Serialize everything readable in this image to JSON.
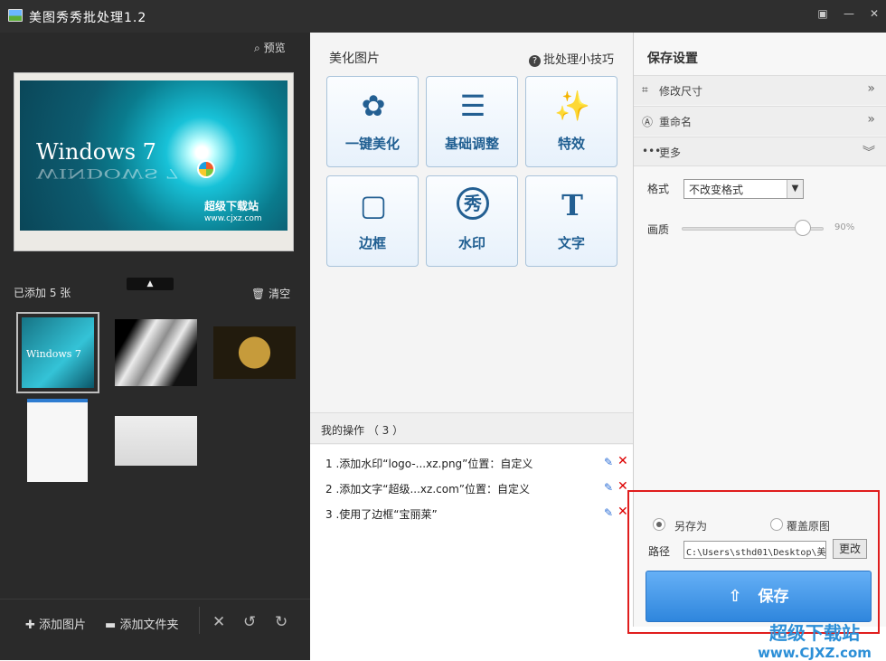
{
  "window": {
    "title": "美图秀秀批处理1.2"
  },
  "left_panel": {
    "preview_label": "预览",
    "preview_text": {
      "windows": "Windows 7",
      "windows_reflection": "WINDOWS 7",
      "site_cn": "超级下载站",
      "site_url": "www.cjxz.com"
    },
    "added_label": "已添加 5 张",
    "clear_label": "清空",
    "thumbnails": [
      {
        "text": "Windows 7"
      },
      {
        "text": ""
      },
      {
        "text": ""
      },
      {
        "text": ""
      },
      {
        "text": ""
      }
    ],
    "bottom": {
      "add_images": "添加图片",
      "add_folder": "添加文件夹"
    }
  },
  "middle_panel": {
    "title": "美化图片",
    "tips": "批处理小技巧",
    "tools": [
      {
        "label": "一键美化"
      },
      {
        "label": "基础调整"
      },
      {
        "label": "特效"
      },
      {
        "label": "边框"
      },
      {
        "label": "水印"
      },
      {
        "label": "文字"
      }
    ],
    "operations_title": "我的操作 （ 3 ）",
    "operations": [
      "1 .添加水印“logo-...xz.png”位置：自定义",
      "2 .添加文字“超级...xz.com”位置：自定义",
      "3 .使用了边框“宝丽莱”"
    ]
  },
  "right_panel": {
    "title": "保存设置",
    "sections": [
      {
        "label": "修改尺寸"
      },
      {
        "label": "重命名"
      },
      {
        "label": "更多"
      }
    ],
    "format_label": "格式",
    "format_value": "不改变格式",
    "quality_label": "画质",
    "quality_value": "90%",
    "quality_level": 0.9,
    "save_as_label": "另存为",
    "overwrite_label": "覆盖原图",
    "path_label": "路径",
    "path_value": "C:\\Users\\sthd01\\Desktop\\美",
    "change_label": "更改",
    "save_button": "保存"
  },
  "watermark": {
    "line1": "超级下载站",
    "line2": "www.CJXZ.com"
  },
  "colors": {
    "accent": "#3a8fe8",
    "highlight": "#e01d1d"
  }
}
